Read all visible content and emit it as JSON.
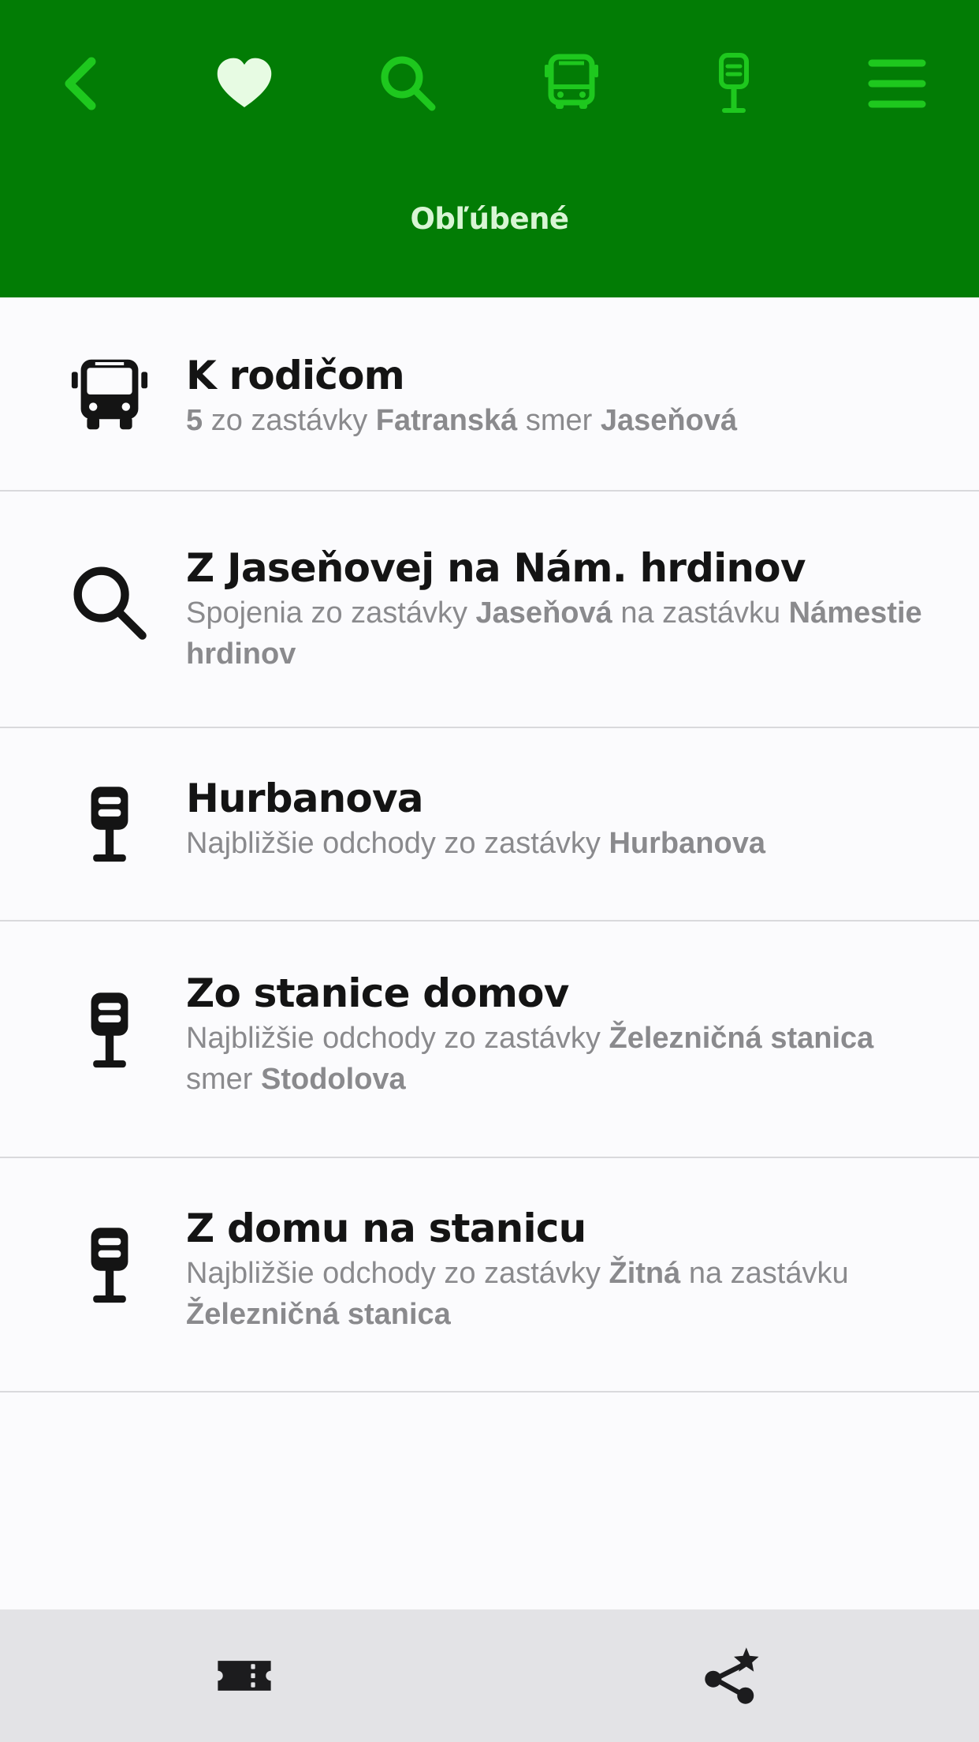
{
  "header": {
    "title": "Obľúbené",
    "icons": [
      "back-icon",
      "heart-icon",
      "search-icon",
      "bus-icon",
      "bus-stop-icon",
      "menu-icon"
    ],
    "colors": {
      "background": "#027c05",
      "accent": "#1ec81e",
      "active": "#e7fbe3"
    }
  },
  "favorites": [
    {
      "icon": "bus-icon",
      "title": "K rodičom",
      "subtitle": [
        {
          "t": "5",
          "b": true
        },
        {
          "t": " zo zastávky ",
          "b": false
        },
        {
          "t": "Fatranská",
          "b": true
        },
        {
          "t": " smer ",
          "b": false
        },
        {
          "t": "Jaseňová",
          "b": true
        }
      ]
    },
    {
      "icon": "search-icon",
      "title": "Z Jaseňovej na Nám. hrdinov",
      "subtitle": [
        {
          "t": "Spojenia zo zastávky ",
          "b": false
        },
        {
          "t": "Jaseňová",
          "b": true
        },
        {
          "t": " na zastávku ",
          "b": false
        },
        {
          "t": "Námestie hrdinov",
          "b": true
        }
      ]
    },
    {
      "icon": "bus-stop-icon",
      "title": "Hurbanova",
      "subtitle": [
        {
          "t": "Najbližšie odchody zo zastávky ",
          "b": false
        },
        {
          "t": "Hurbanova",
          "b": true
        }
      ]
    },
    {
      "icon": "bus-stop-icon",
      "title": "Zo stanice domov",
      "subtitle": [
        {
          "t": "Najbližšie odchody zo zastávky ",
          "b": false
        },
        {
          "t": "Železničná stanica",
          "b": true
        },
        {
          "t": " smer ",
          "b": false
        },
        {
          "t": "Stodolova",
          "b": true
        }
      ]
    },
    {
      "icon": "bus-stop-icon",
      "title": "Z domu na stanicu",
      "subtitle": [
        {
          "t": "Najbližšie odchody zo zastávky ",
          "b": false
        },
        {
          "t": "Žitná",
          "b": true
        },
        {
          "t": " na zastávku ",
          "b": false
        },
        {
          "t": "Železničná stanica",
          "b": true
        }
      ]
    }
  ],
  "bottom_bar": {
    "icons": [
      "ticket-icon",
      "share-star-icon"
    ]
  }
}
